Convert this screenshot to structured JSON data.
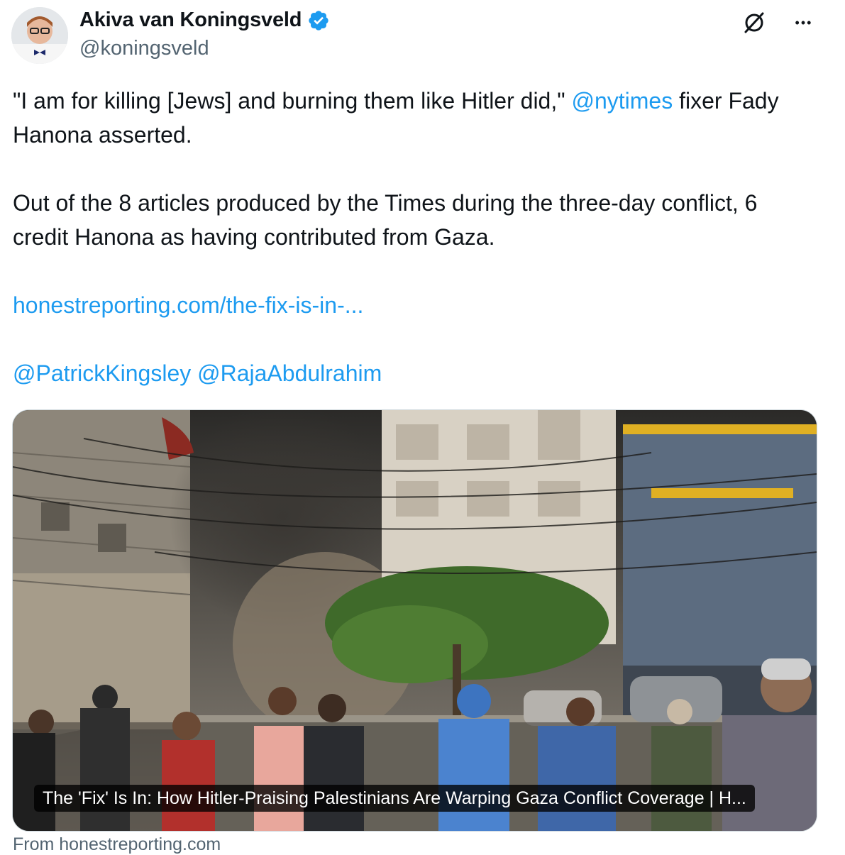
{
  "author": {
    "display_name": "Akiva van Koningsveld",
    "handle": "@koningsveld",
    "verified_icon": "verified-badge-icon"
  },
  "actions": {
    "grok_icon": "grok-icon",
    "more_icon": "more-options-icon",
    "more_label": "•••"
  },
  "tweet": {
    "p1_part1": "\"I am for killing [Jews] and burning them like Hitler did,\" ",
    "p1_mention": "@nytimes",
    "p1_part2": " fixer Fady Hanona asserted.",
    "p2": "Out of the 8 articles produced by the Times during the three-day conflict, 6 credit Hanona as having contributed from Gaza.",
    "link": "honestreporting.com/the-fix-is-in-...",
    "mention1": "@PatrickKingsley",
    "mention2": "@RajaAbdulrahim"
  },
  "card": {
    "title": "The 'Fix' Is In: How Hitler-Praising Palestinians Are Warping Gaza Conflict Coverage | H...",
    "source": "From honestreporting.com"
  },
  "colors": {
    "link": "#1d9bf0",
    "verified": "#1d9bf0",
    "secondary_text": "#536471"
  }
}
